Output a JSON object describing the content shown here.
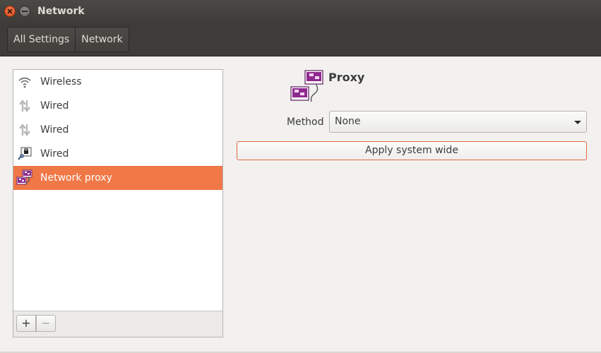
{
  "window": {
    "title": "Network"
  },
  "breadcrumbs": [
    "All Settings",
    "Network"
  ],
  "sidebar": {
    "items": [
      {
        "label": "Wireless",
        "icon": "wireless-icon",
        "selected": false
      },
      {
        "label": "Wired",
        "icon": "wired-icon",
        "selected": false
      },
      {
        "label": "Wired",
        "icon": "wired-icon",
        "selected": false
      },
      {
        "label": "Wired",
        "icon": "wired-vpn-icon",
        "selected": false
      },
      {
        "label": "Network proxy",
        "icon": "network-proxy-icon",
        "selected": true
      }
    ],
    "add_label": "+",
    "remove_label": "−"
  },
  "proxy": {
    "title": "Proxy",
    "method_label": "Method",
    "method_value": "None",
    "apply_label": "Apply system wide"
  },
  "colors": {
    "accent": "#f07746",
    "titlebar": "#3d3c38",
    "proxy_icon": "#8e2a8e"
  }
}
